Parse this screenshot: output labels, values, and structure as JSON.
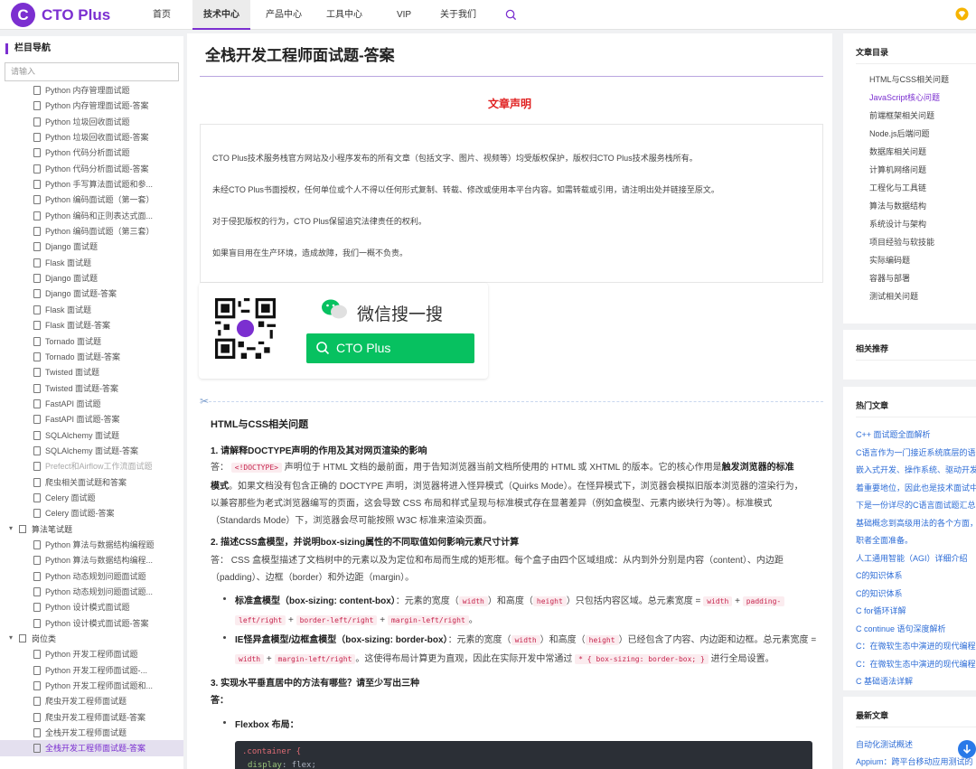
{
  "logo": {
    "mark": "C",
    "text": "CTO Plus"
  },
  "nav": [
    {
      "label": "首页",
      "active": false
    },
    {
      "label": "技术中心",
      "active": true
    },
    {
      "label": "产品中心",
      "active": false
    },
    {
      "label": "工具中心",
      "active": false
    },
    {
      "label": "VIP",
      "active": false
    },
    {
      "label": "关于我们",
      "active": false
    }
  ],
  "colors": {
    "accent": "#7b2fd0",
    "link": "#2d6cd6",
    "warning": "#e02020",
    "wechat": "#07c160"
  },
  "sidebar": {
    "title": "栏目导航",
    "search_placeholder": "请输入",
    "items": [
      {
        "label": "Python 内存管理面试题",
        "kind": "child"
      },
      {
        "label": "Python 内存管理面试题-答案",
        "kind": "child"
      },
      {
        "label": "Python 垃圾回收面试题",
        "kind": "child"
      },
      {
        "label": "Python 垃圾回收面试题-答案",
        "kind": "child"
      },
      {
        "label": "Python 代码分析面试题",
        "kind": "child"
      },
      {
        "label": "Python 代码分析面试题-答案",
        "kind": "child"
      },
      {
        "label": "Python 手写算法面试题和参...",
        "kind": "child"
      },
      {
        "label": "Python 编码面试题（第一套）",
        "kind": "child"
      },
      {
        "label": "Python 编码和正则表达式面...",
        "kind": "child"
      },
      {
        "label": "Python 编码面试题（第三套）",
        "kind": "child"
      },
      {
        "label": "Django 面试题",
        "kind": "child"
      },
      {
        "label": "Flask 面试题",
        "kind": "child"
      },
      {
        "label": "Django 面试题",
        "kind": "child"
      },
      {
        "label": "Django 面试题-答案",
        "kind": "child"
      },
      {
        "label": "Flask 面试题",
        "kind": "child"
      },
      {
        "label": "Flask 面试题-答案",
        "kind": "child"
      },
      {
        "label": "Tornado 面试题",
        "kind": "child"
      },
      {
        "label": "Tornado 面试题-答案",
        "kind": "child"
      },
      {
        "label": "Twisted 面试题",
        "kind": "child"
      },
      {
        "label": "Twisted 面试题-答案",
        "kind": "child"
      },
      {
        "label": "FastAPI 面试题",
        "kind": "child"
      },
      {
        "label": "FastAPI 面试题-答案",
        "kind": "child"
      },
      {
        "label": "SQLAlchemy 面试题",
        "kind": "child"
      },
      {
        "label": "SQLAlchemy 面试题-答案",
        "kind": "child"
      },
      {
        "label": "Prefect和Airflow工作流面试题",
        "kind": "child",
        "muted": true
      },
      {
        "label": "爬虫相关面试题和答案",
        "kind": "child"
      },
      {
        "label": "Celery 面试题",
        "kind": "child"
      },
      {
        "label": "Celery 面试题-答案",
        "kind": "child"
      },
      {
        "label": "算法笔试题",
        "kind": "folder"
      },
      {
        "label": "Python 算法与数据结构编程题",
        "kind": "child"
      },
      {
        "label": "Python 算法与数据结构编程...",
        "kind": "child"
      },
      {
        "label": "Python 动态规划问题面试题",
        "kind": "child"
      },
      {
        "label": "Python 动态规划问题面试题...",
        "kind": "child"
      },
      {
        "label": "Python 设计模式面试题",
        "kind": "child"
      },
      {
        "label": "Python 设计模式面试题-答案",
        "kind": "child"
      },
      {
        "label": "岗位类",
        "kind": "folder"
      },
      {
        "label": "Python 开发工程师面试题",
        "kind": "child"
      },
      {
        "label": "Python 开发工程师面试题-...",
        "kind": "child"
      },
      {
        "label": "Python 开发工程师面试题和...",
        "kind": "child"
      },
      {
        "label": "爬虫开发工程师面试题",
        "kind": "child"
      },
      {
        "label": "爬虫开发工程师面试题-答案",
        "kind": "child"
      },
      {
        "label": "全栈开发工程师面试题",
        "kind": "child"
      },
      {
        "label": "全栈开发工程师面试题-答案",
        "kind": "child",
        "selected": true
      }
    ]
  },
  "article": {
    "title": "全栈开发工程师面试题-答案",
    "declaration_title": "文章声明",
    "declaration_lines": [
      "CTO Plus技术服务栈官方网站及小程序发布的所有文章（包括文字、图片、视频等）均受版权保护，版权归CTO Plus技术服务栈所有。",
      "未经CTO Plus书面授权，任何单位或个人不得以任何形式复制、转载、修改或使用本平台内容。如需转载或引用，请注明出处并链接至原文。",
      "对于侵犯版权的行为，CTO Plus保留追究法律责任的权利。",
      "如果盲目用在生产环境，造成故障，我们一概不负责。"
    ],
    "wechat": {
      "title": "微信搜一搜",
      "search_text": "CTO Plus"
    },
    "section_title": "HTML与CSS相关问题",
    "q1": "1. 请解释DOCTYPE声明的作用及其对网页渲染的影响",
    "answer_label": "答：",
    "q1_code": "<!DOCTYPE>",
    "q1_a1": "声明位于 HTML 文档的最前面，用于告知浏览器当前文档所使用的 HTML 或 XHTML 的版本。它的核心作用是",
    "q1_a1_bold": "触发浏览器的标准",
    "q1_a2_bold": "模式",
    "q1_a2": "。如果文档没有包含正确的 DOCTYPE 声明，浏览器将进入怪异模式（Quirks Mode）。在怪异模式下，浏览器会模拟旧版本浏览器的渲染行为，",
    "q1_a3": "以兼容那些为老式浏览器编写的页面，这会导致 CSS 布局和样式呈现与标准模式存在显著差异（例如盒模型、元素内嵌块行为等）。标准模式",
    "q1_a4": "（Standards Mode）下，浏览器会尽可能按照 W3C 标准来渲染页面。",
    "q2": "2. 描述CSS盒模型，并说明box-sizing属性的不同取值如何影响元素尺寸计算",
    "q2_a1": "CSS 盒模型描述了文档树中的元素以及为定位和布局而生成的矩形框。每个盒子由四个区域组成：从内到外分别是内容（content）、内边距",
    "q2_a2": "（padding）、边框（border）和外边距（margin）。",
    "b1_bold": "标准盒模型（box-sizing: content-box）",
    "b1_text1": "：元素的宽度（",
    "b1_c1": "width",
    "b1_text2": "）和高度（",
    "b1_c2": "height",
    "b1_text3": "）只包括内容区域。总元素宽度 =",
    "b1_c3": "width",
    "b1_c4": "padding-",
    "b1_c5": "left/right",
    "b1_c6": "border-left/right",
    "b1_c7": "margin-left/right",
    "b2_bold": "IE怪异盒模型/边框盒模型（box-sizing: border-box）",
    "b2_text1": "：元素的宽度（",
    "b2_c1": "width",
    "b2_text2": "）和高度（",
    "b2_c2": "height",
    "b2_text3": "）已经包含了内容、内边距和边框。总元素宽度 =",
    "b2_c3": "width",
    "b2_c4": "margin-left/right",
    "b2_text4": "。这使得布局计算更为直观，因此在实际开发中常通过",
    "b2_c5": "* { box-sizing: border-box; }",
    "b2_text5": "进行全局设置。",
    "plus": "+",
    "dot": "。",
    "q3": "3. 实现水平垂直居中的方法有哪些？请至少写出三种",
    "q3_answer_label": "答：",
    "flex_label": "Flexbox 布局：",
    "code_line1": ".container {",
    "code_line2_key": "display",
    "code_line2_val": "flex;"
  },
  "toc": {
    "title": "文章目录",
    "items": [
      {
        "label": "HTML与CSS相关问题",
        "active": false
      },
      {
        "label": "JavaScript核心问题",
        "active": true
      },
      {
        "label": "前端框架相关问题",
        "active": false
      },
      {
        "label": "Node.js后端问题",
        "active": false
      },
      {
        "label": "数据库相关问题",
        "active": false
      },
      {
        "label": "计算机网络问题",
        "active": false
      },
      {
        "label": "工程化与工具链",
        "active": false
      },
      {
        "label": "算法与数据结构",
        "active": false
      },
      {
        "label": "系统设计与架构",
        "active": false
      },
      {
        "label": "项目经验与软技能",
        "active": false
      },
      {
        "label": "实际编码题",
        "active": false
      },
      {
        "label": "容器与部署",
        "active": false
      },
      {
        "label": "测试相关问题",
        "active": false
      }
    ]
  },
  "related": {
    "title": "相关推荐"
  },
  "hot": {
    "title": "热门文章",
    "items": [
      "C++ 面试题全面解析",
      "C语言作为一门接近系统底层的语",
      "嵌入式开发、操作系统、驱动开发",
      "着重要地位，因此也是技术面试中",
      "下是一份详尽的C语言面试题汇总",
      "基础概念到高级用法的各个方面，",
      "职者全面准备。",
      "人工通用智能（AGI）详细介绍",
      "C的知识体系",
      "C的知识体系",
      "C for循环详解",
      "C continue 语句深度解析",
      "C：在微软生态中演进的现代编程",
      "C：在微软生态中演进的现代编程",
      "C 基础语法详解"
    ]
  },
  "latest": {
    "title": "最新文章",
    "items": [
      "自动化测试概述",
      "Appium：跨平台移动应用测试的"
    ]
  }
}
